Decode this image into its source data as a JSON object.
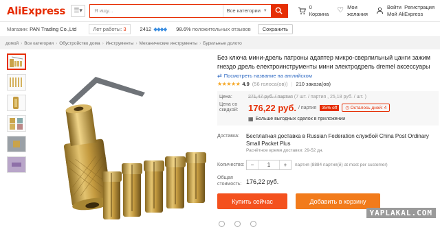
{
  "header": {
    "logo": "AliExpress",
    "search_placeholder": "Я ищу...",
    "search_category": "Все категории",
    "cart_label": "0",
    "cart_sub": "Корзина",
    "wish_label": "Мои",
    "wish_sub": "желания",
    "login_label": "Войти",
    "login_sub": "Мой AliExpress",
    "register": "Регистрация"
  },
  "store": {
    "label": "Магазин:",
    "name": "PAN Trading Co.,Ltd",
    "years_label": "Лет работы:",
    "years_value": "3",
    "score": "2412",
    "diamonds": "◆◆◆◆",
    "positive_pct": "98.6%",
    "positive_label": "положительных отзывов",
    "save": "Сохранить"
  },
  "breadcrumbs": [
    "домой",
    "Все категории",
    "Обустройство дома",
    "Инструменты",
    "Механические инструменты",
    "Бурильные долото"
  ],
  "product": {
    "title": "Без ключа мини-дрель патроны адаптер микро-сверлильный цанги зажим гнездо дрель електроинструменты мини электродрель dremel аксессуары",
    "translate": "Посмотреть название на английском",
    "stars": "★★★★★",
    "rating": "4.9",
    "votes": "(56 голоса(ов))",
    "orders": "210 заказа(ов)"
  },
  "price": {
    "label_price": "Цена:",
    "old_price": "271,47 руб. / партия",
    "old_price_note": "(7 шт. / партия , 25,18 руб. / шт. )",
    "label_discount": "Цена со скидкой:",
    "new_price": "176,22 руб.",
    "new_unit": "/ партия",
    "off": "35% off",
    "days_left": "Осталось дней: 4",
    "app_deal": "Больше выгодных сделок в приложении"
  },
  "shipping": {
    "label": "Доставка:",
    "text": "Бесплатная доставка в Russian Federation службой China Post Ordinary Small Packet Plus",
    "eta": "Расчётное время доставки: 29-52 дн."
  },
  "quantity": {
    "label": "Количество:",
    "minus": "−",
    "value": "1",
    "plus": "+",
    "note": "партия (8884 партия(й) at most per customer)"
  },
  "total": {
    "label": "Общая стоимость:",
    "value": "176,22 руб."
  },
  "buttons": {
    "buy": "Купить сейчас",
    "cart": "Добавить в корзину"
  },
  "watermark": "YAPLAKAL.COM",
  "colors": {
    "brand": "#e62e04",
    "buy": "#f4511e",
    "cart": "#f27b1b",
    "link": "#2b67c1"
  }
}
